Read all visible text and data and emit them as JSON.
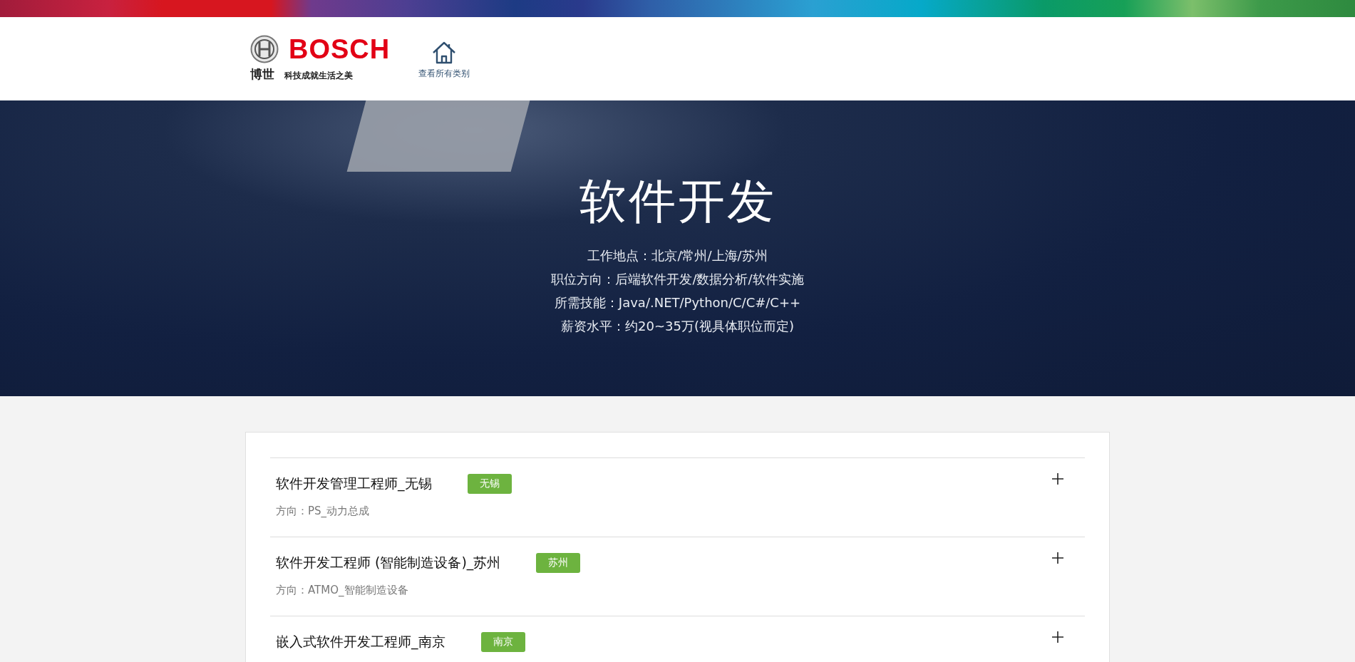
{
  "header": {
    "logo": {
      "wordmark": "BOSCH",
      "brand_cn": "博世",
      "slogan": "科技成就生活之美"
    },
    "home_link": {
      "label": "查看所有类别"
    }
  },
  "hero": {
    "title": "软件开发",
    "lines": [
      "工作地点：北京/常州/上海/苏州",
      "职位方向：后端软件开发/数据分析/软件实施",
      "所需技能：Java/.NET/Python/C/C#/C++",
      "薪资水平：约20~35万(视具体职位而定)"
    ]
  },
  "jobs": [
    {
      "title": "软件开发管理工程师_无锡",
      "tag": "无锡",
      "direction": "方向：PS_动力总成",
      "expanded": false
    },
    {
      "title": "软件开发工程师 (智能制造设备)_苏州",
      "tag": "苏州",
      "direction": "方向：ATMO_智能制造设备",
      "expanded": false
    },
    {
      "title": "嵌入式软件开发工程师_南京",
      "tag": "南京",
      "expanded": false
    }
  ]
}
